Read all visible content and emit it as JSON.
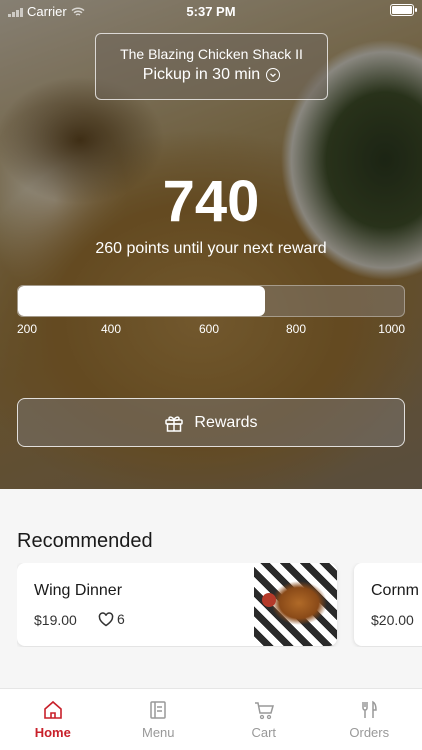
{
  "status_bar": {
    "carrier": "Carrier",
    "time": "5:37 PM"
  },
  "store": {
    "name": "The Blazing Chicken Shack II",
    "pickup": "Pickup in 30 min"
  },
  "rewards": {
    "points": "740",
    "subtitle": "260 points until your next reward",
    "progress_fraction": 0.64,
    "ticks": [
      "200",
      "400",
      "600",
      "800",
      "1000"
    ],
    "button_label": "Rewards"
  },
  "recommended": {
    "title": "Recommended",
    "items": [
      {
        "name": "Wing Dinner",
        "price": "$19.00",
        "likes": "6"
      },
      {
        "name": "Cornm",
        "price": "$20.00"
      }
    ]
  },
  "tabs": [
    {
      "label": "Home",
      "icon": "home-icon",
      "active": true
    },
    {
      "label": "Menu",
      "icon": "menu-icon"
    },
    {
      "label": "Cart",
      "icon": "cart-icon"
    },
    {
      "label": "Orders",
      "icon": "orders-icon"
    }
  ],
  "colors": {
    "accent": "#c8202a"
  }
}
